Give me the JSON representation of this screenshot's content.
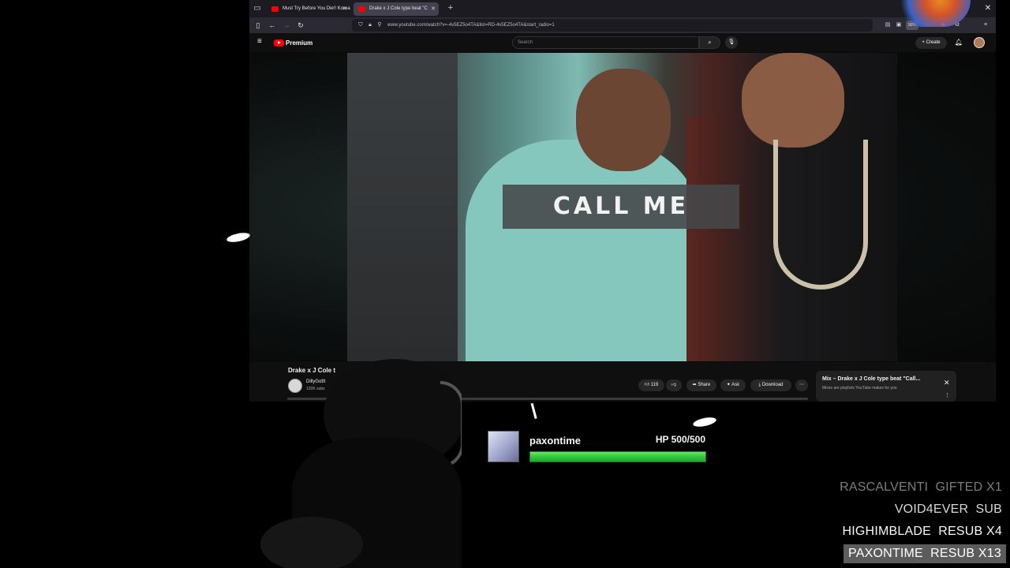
{
  "browser": {
    "tabs": [
      {
        "label": "Must Try Before You Die!! Korea",
        "active": false
      },
      {
        "label": "Drake x J Cole type beat \"C",
        "active": true
      }
    ],
    "url": "www.youtube.com/watch?v=-4v5EZ5o4TA&list=RD-4v5EZ5o4TA&start_radio=1",
    "zoom": "90%"
  },
  "youtube": {
    "brand": "Premium",
    "search_placeholder": "Search",
    "create_label": "Create",
    "video_overlay_text": "CALL ME",
    "video_title": "Drake x J Cole t",
    "channel_name": "DillyGotIt",
    "channel_subs": "120K subs",
    "like_count": "119",
    "actions": {
      "share": "Share",
      "ask": "Ask",
      "download": "Download"
    },
    "mix": {
      "title": "Mix – Drake x J Cole type beat \"Call...",
      "subtitle": "Mixes are playlists YouTube makes for you"
    }
  },
  "overlay": {
    "hp": {
      "name": "paxontime",
      "label": "HP 500/500",
      "current": 500,
      "max": 500
    },
    "alerts": [
      {
        "text": "RASCALVENTI  GIFTED X1"
      },
      {
        "text": "VOID4EVER  SUB"
      },
      {
        "text": "HIGHIMBLADE  RESUB X4"
      },
      {
        "text": "PAXONTIME  RESUB X13"
      }
    ]
  },
  "colors": {
    "yt_red": "#ff0000",
    "hp_green": "#32c83a",
    "browser_bg": "#1c1b22"
  }
}
